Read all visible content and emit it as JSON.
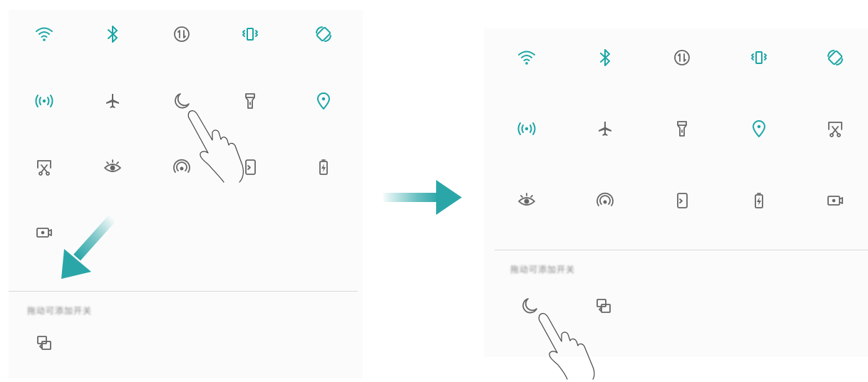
{
  "colors": {
    "accent": "#1ba6a6",
    "dim": "#666666",
    "arrow": "#2aa6a8"
  },
  "left_panel": {
    "section_label": "拖动可添加开关",
    "active_rows": [
      [
        "wifi-icon",
        "bluetooth-icon",
        "mobile-data-icon",
        "vibrate-icon",
        "auto-rotate-icon"
      ],
      [
        "hotspot-icon",
        "airplane-icon",
        "do-not-disturb-icon",
        "flashlight-icon",
        "location-icon"
      ],
      [
        "screenshot-icon",
        "eye-comfort-icon",
        "nfc-icon",
        "huawei-share-icon",
        "battery-saver-icon"
      ],
      [
        "screen-recorder-icon"
      ]
    ],
    "inactive": [
      "screen-projection-icon"
    ]
  },
  "right_panel": {
    "section_label": "拖动可添加开关",
    "active_rows": [
      [
        "wifi-icon",
        "bluetooth-icon",
        "mobile-data-icon",
        "vibrate-icon",
        "auto-rotate-icon"
      ],
      [
        "hotspot-icon",
        "airplane-icon",
        "flashlight-icon",
        "location-icon",
        "screenshot-icon"
      ],
      [
        "eye-comfort-icon",
        "nfc-icon",
        "huawei-share-icon",
        "battery-saver-icon",
        "screen-recorder-icon"
      ]
    ],
    "inactive": [
      "do-not-disturb-icon",
      "screen-projection-icon"
    ]
  }
}
